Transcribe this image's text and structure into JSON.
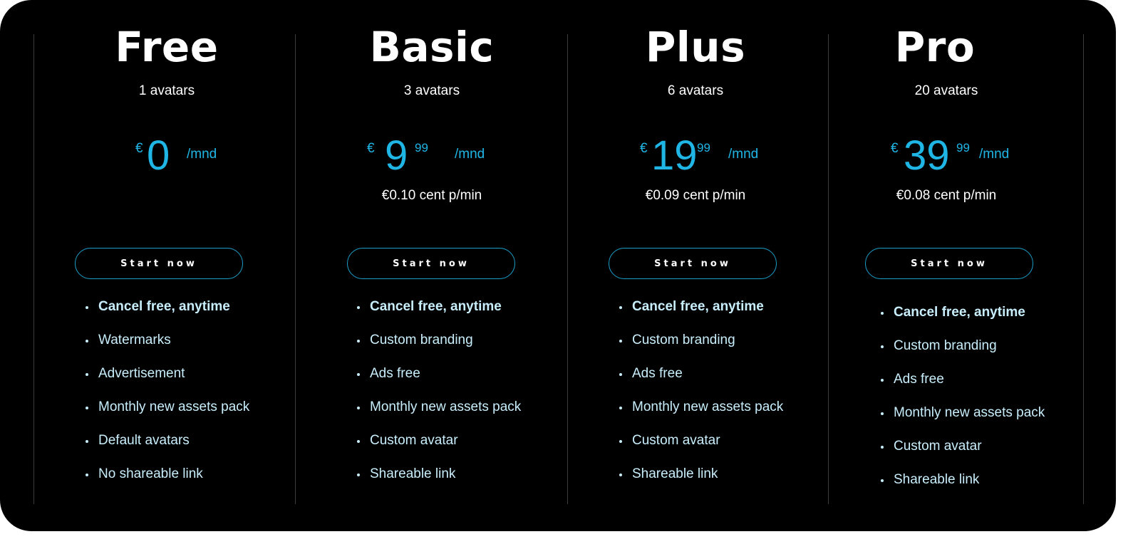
{
  "plans": [
    {
      "name": "Free",
      "avatars": "1 avatars",
      "price": {
        "currency": "€",
        "amount": "0",
        "cents": "",
        "period": "/mnd"
      },
      "cost_per_minute": "",
      "cta_label": "Start now",
      "features": [
        "Cancel free, anytime",
        "Watermarks",
        "Advertisement",
        "Monthly new assets pack",
        "Default avatars",
        "No shareable link"
      ]
    },
    {
      "name": "Basic",
      "avatars": "3 avatars",
      "price": {
        "currency": "€",
        "amount": "9",
        "cents": "99",
        "period": "/mnd"
      },
      "cost_per_minute": "€0.10 cent p/min",
      "cta_label": "Start now",
      "features": [
        "Cancel free, anytime",
        "Custom branding",
        "Ads free",
        "Monthly new assets pack",
        "Custom avatar",
        "Shareable link"
      ]
    },
    {
      "name": "Plus",
      "avatars": "6 avatars",
      "price": {
        "currency": "€",
        "amount": "19",
        "cents": "99",
        "period": "/mnd"
      },
      "cost_per_minute": "€0.09 cent p/min",
      "cta_label": "Start now",
      "features": [
        "Cancel free, anytime",
        "Custom branding",
        "Ads free",
        "Monthly new assets pack",
        "Custom avatar",
        "Shareable link"
      ]
    },
    {
      "name": "Pro",
      "avatars": "20 avatars",
      "price": {
        "currency": "€",
        "amount": "39",
        "cents": "99",
        "period": "/mnd"
      },
      "cost_per_minute": "€0.08 cent p/min",
      "cta_label": "Start now",
      "features": [
        "Cancel free, anytime",
        "Custom branding",
        "Ads free",
        "Monthly new assets pack",
        "Custom avatar",
        "Shareable link"
      ]
    }
  ],
  "colors": {
    "background": "#000000",
    "accent": "#1fb6e6",
    "button_border": "#1c9fcb",
    "feature_text": "#c8eefc"
  }
}
